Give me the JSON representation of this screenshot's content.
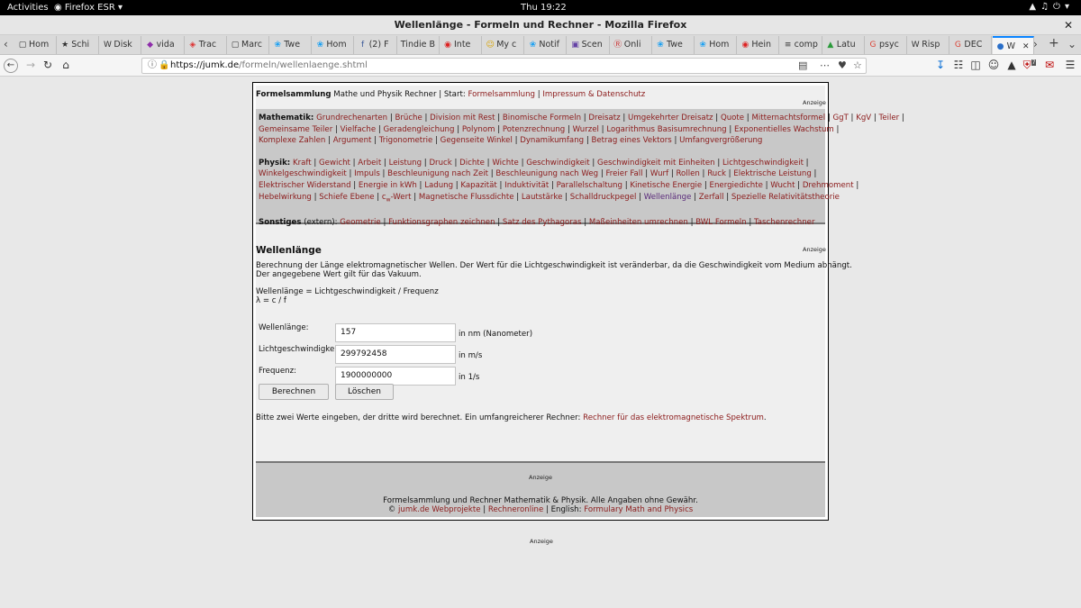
{
  "system": {
    "activities": "Activities",
    "app": "Firefox ESR",
    "clock": "Thu 19:22"
  },
  "window": {
    "title": "Wellenlänge - Formeln und Rechner - Mozilla Firefox"
  },
  "tabs": [
    {
      "label": "Hom",
      "icon": "grey-doc-icon"
    },
    {
      "label": "Schi",
      "icon": "star-icon"
    },
    {
      "label": "Disk",
      "icon": "wikipedia-icon"
    },
    {
      "label": "vida",
      "icon": "purple-logo-icon"
    },
    {
      "label": "Trac",
      "icon": "red-cube-icon"
    },
    {
      "label": "Marc",
      "icon": "grey-doc-icon"
    },
    {
      "label": "Twe",
      "icon": "twitter-icon"
    },
    {
      "label": "Hom",
      "icon": "twitter-icon"
    },
    {
      "label": "(2) F",
      "icon": "facebook-icon"
    },
    {
      "label": "Tindie B",
      "icon": "none"
    },
    {
      "label": "Inte",
      "icon": "red-circle-icon"
    },
    {
      "label": "My c",
      "icon": "yellow-face-icon"
    },
    {
      "label": "Notif",
      "icon": "twitter-icon"
    },
    {
      "label": "Scen",
      "icon": "twitch-icon"
    },
    {
      "label": "Onli",
      "icon": "cr-icon"
    },
    {
      "label": "Twe",
      "icon": "twitter-icon"
    },
    {
      "label": "Hom",
      "icon": "twitter-icon"
    },
    {
      "label": "Hein",
      "icon": "red-circle-icon"
    },
    {
      "label": "comp",
      "icon": "lines-icon"
    },
    {
      "label": "Latu",
      "icon": "green-a-icon"
    },
    {
      "label": "psyc",
      "icon": "google-icon"
    },
    {
      "label": "Risp",
      "icon": "wikipedia-icon"
    },
    {
      "label": "DEC",
      "icon": "google-icon"
    },
    {
      "label": "W",
      "icon": "globe-icon"
    }
  ],
  "nav": {
    "url_host": "https://jumk.de",
    "url_path": "/formeln/wellenlaenge.shtml",
    "addon_badge": "7"
  },
  "site": {
    "header_title": "Formelsammlung",
    "header_text": " Mathe und Physik Rechner | Start: ",
    "link_start": "Formelsammlung",
    "sep": " | ",
    "link_impressum": "Impressum & Datenschutz",
    "ad_label": "Anzeige",
    "math_label": "Mathematik:",
    "math_rows": [
      [
        "Grundrechenarten",
        "Brüche",
        "Division mit Rest",
        "Binomische Formeln",
        "Dreisatz",
        "Umgekehrter Dreisatz",
        "Quote",
        "Mitternachtsformel",
        "GgT",
        "KgV",
        "Teiler"
      ],
      [
        "Gemeinsame Teiler",
        "Vielfache",
        "Geradengleichung",
        "Polynom",
        "Potenzrechnung",
        "Wurzel",
        "Logarithmus Basisumrechnung",
        "Exponentielles Wachstum"
      ],
      [
        "Komplexe Zahlen",
        "Argument",
        "Trigonometrie",
        "Gegenseite Winkel",
        "Dynamikumfang",
        "Betrag eines Vektors",
        "Umfangvergrößerung"
      ]
    ],
    "physics_label": "Physik:",
    "physics_rows": [
      [
        "Kraft",
        "Gewicht",
        "Arbeit",
        "Leistung",
        "Druck",
        "Dichte",
        "Wichte",
        "Geschwindigkeit",
        "Geschwindigkeit mit Einheiten",
        "Lichtgeschwindigkeit"
      ],
      [
        "Winkelgeschwindigkeit",
        "Impuls",
        "Beschleunigung nach Zeit",
        "Beschleunigung nach Weg",
        "Freier Fall",
        "Wurf",
        "Rollen",
        "Ruck",
        "Elektrische Leistung"
      ],
      [
        "Elektrischer Widerstand",
        "Energie in kWh",
        "Ladung",
        "Kapazität",
        "Induktivität",
        "Parallelschaltung",
        "Kinetische Energie",
        "Energiedichte",
        "Wucht",
        "Drehmoment"
      ],
      [
        "Hebelwirkung",
        "Schiefe Ebene",
        "cw-Wert",
        "Magnetische Flussdichte",
        "Lautstärke",
        "Schalldruckpegel",
        "Wellenlänge",
        "Zerfall",
        "Spezielle Relativitätstheorie"
      ]
    ],
    "other_label": "Sonstiges",
    "other_suffix": " (extern):",
    "other_links": [
      "Geometrie",
      "Funktionsgraphen zeichnen",
      "Satz des Pythagoras",
      "Maßeinheiten umrechnen",
      "BWL Formeln",
      "Taschenrechner"
    ],
    "page_title": "Wellenlänge",
    "desc1": "Berechnung der Länge elektromagnetischer Wellen. Der Wert für die Lichtgeschwindigkeit ist veränderbar, da die Geschwindigkeit vom Medium abhängt.",
    "desc2": "Der angegebene Wert gilt für das Vakuum.",
    "formula1": "Wellenlänge = Lichtgeschwindigkeit / Frequenz",
    "formula2": "λ = c / f",
    "fields": [
      {
        "label": "Wellenlänge:",
        "value": "157",
        "unit": "in nm (Nanometer)"
      },
      {
        "label": "Lichtgeschwindigkeit:",
        "value": "299792458",
        "unit": "in m/s"
      },
      {
        "label": "Frequenz:",
        "value": "1900000000",
        "unit": "in 1/s"
      }
    ],
    "btn_calc": "Berechnen",
    "btn_clear": "Löschen",
    "hint": "Bitte zwei Werte eingeben, der dritte wird berechnet. Ein umfangreicherer Rechner: ",
    "hint_link": "Rechner für das elektromagnetische Spektrum",
    "footer_line1": "Formelsammlung und Rechner Mathematik & Physik. Alle Angaben ohne Gewähr.",
    "footer_copy": "© ",
    "footer_link1": "jumk.de Webprojekte",
    "footer_link2": "Rechneronline",
    "footer_english": " | English: ",
    "footer_link3": "Formulary Math and Physics"
  }
}
